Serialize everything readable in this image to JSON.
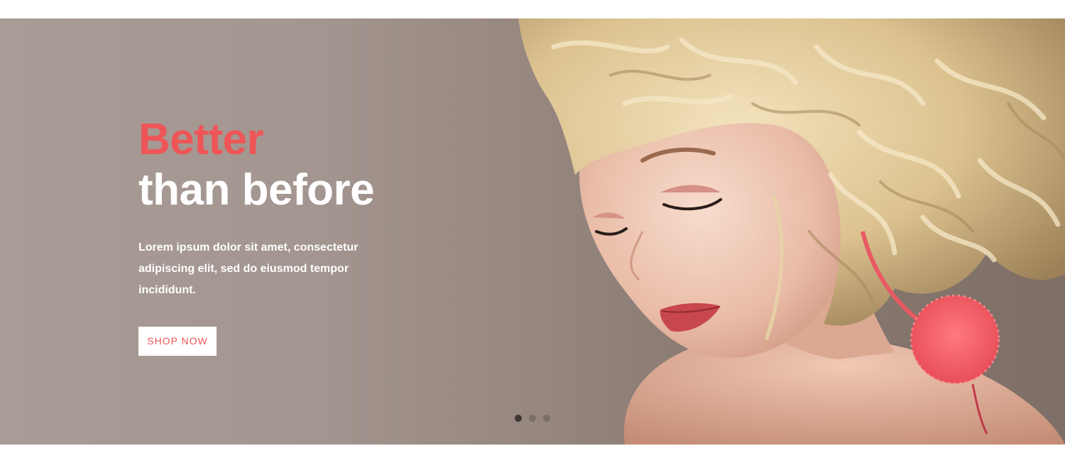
{
  "hero": {
    "title_accent": "Better",
    "title_main": "than before",
    "description": "Lorem ipsum dolor sit amet, consectetur adipiscing elit, sed do eiusmod tempor incididunt.",
    "button_label": "SHOP NOW",
    "photo": "woman-with-curly-blonde-hair-portrait"
  },
  "carousel": {
    "slides": 3,
    "active_index": 0
  },
  "colors": {
    "accent": "#ee5557",
    "text": "#ffffff",
    "button_background": "#ffffff",
    "dot_active": "#3e3633"
  }
}
